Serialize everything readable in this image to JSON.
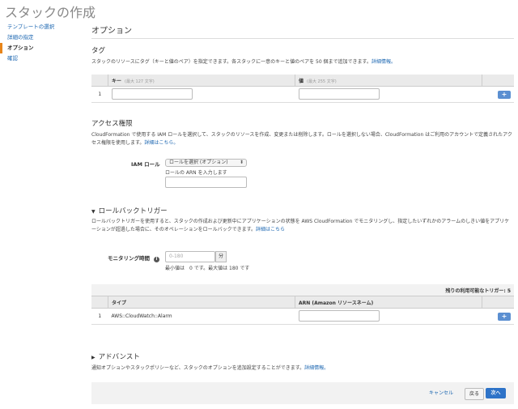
{
  "page_title": "スタックの作成",
  "nav": [
    {
      "label": "テンプレートの選択",
      "active": false
    },
    {
      "label": "詳細の指定",
      "active": false
    },
    {
      "label": "オプション",
      "active": true
    },
    {
      "label": "確認",
      "active": false
    }
  ],
  "options": {
    "title": "オプション"
  },
  "tags": {
    "title": "タグ",
    "desc": "スタックのリソースにタグ（キーと値のペア）を指定できます。各スタックに一意のキーと値のペアを 50 個まで追加できます。",
    "link": "詳細情報。",
    "col_key": "キー",
    "col_key_hint": "(最大 127 文字)",
    "col_value": "値",
    "col_value_hint": "(最大 255 文字)",
    "row_number": "1",
    "add": "+"
  },
  "access": {
    "title": "アクセス権限",
    "desc": "CloudFormation で使用する IAM ロールを選択して、スタックのリソースを作成、変更または削除します。ロールを選択しない場合、CloudFormation はご利用のアカウントで定義されたアクセス権限を使用します。",
    "link": "詳細はこちら。",
    "iam_label": "IAM ロール",
    "role_select": "ロールを選択 (オプション)",
    "arn_label": "ロールの ARN を入力します"
  },
  "rollback": {
    "title": "ロールバックトリガー",
    "desc": "ロールバックトリガーを使用すると、スタックの作成および更新中にアプリケーションの状態を AWS CloudFormation でモニタリングし、指定したいずれかのアラームのしきい値をアプリケーションが超過した場合に、そのオペレーションをロールバックできます。",
    "link": "詳細はこちら",
    "monitor_label": "モニタリング時間",
    "monitor_placeholder": "0-180",
    "unit": "分",
    "range_hint": "最小値は　0 です。最大値は 180 です",
    "remaining": "残りの利用可能なトリガー: 5",
    "col_type": "タイプ",
    "col_arn": "ARN (Amazon リソースネーム)",
    "row_number": "1",
    "row_type": "AWS::CloudWatch::Alarm",
    "add": "+"
  },
  "advanced": {
    "title": "アドバンスト",
    "desc": "通知オプションやスタックポリシーなど、スタックのオプションを追加設定することができます。",
    "link": "詳細情報。"
  },
  "footer": {
    "cancel": "キャンセル",
    "back": "戻る",
    "next": "次へ"
  },
  "colors": {
    "accent": "#e8851a",
    "link": "#1b66b1",
    "primary_button": "#2e73c8",
    "add_button": "#5b8fd1"
  }
}
